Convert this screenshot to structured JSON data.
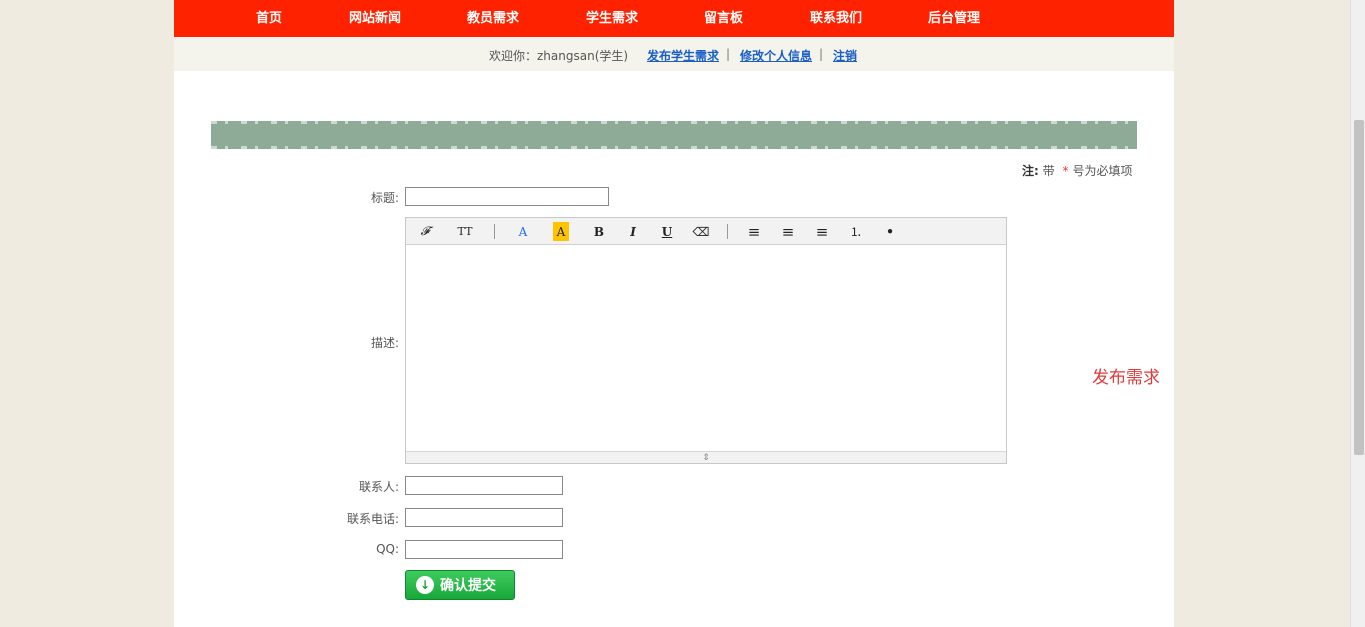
{
  "nav": {
    "items": [
      "首页",
      "网站新闻",
      "教员需求",
      "学生需求",
      "留言板",
      "联系我们",
      "后台管理"
    ]
  },
  "welcome": {
    "text": "欢迎你：zhangsan(学生)",
    "links": [
      "发布学生需求",
      "修改个人信息",
      "注销"
    ],
    "separator": "|"
  },
  "note": {
    "prefix": "注:",
    "middle": "带",
    "star": "*",
    "suffix": "号为必填项"
  },
  "form": {
    "title_label": "标题:",
    "desc_label": "描述:",
    "contact_label": "联系人:",
    "phone_label": "联系电话:",
    "qq_label": "QQ:",
    "title_value": "",
    "contact_value": "",
    "phone_value": "",
    "qq_value": ""
  },
  "editor": {
    "toolbar": {
      "font_family": "𝓕",
      "font_size": "TT",
      "font_color": "A",
      "bg_color": "A",
      "bold": "B",
      "italic": "I",
      "underline": "U",
      "eraser": "⌫",
      "align_left": "≡",
      "align_center": "≡",
      "align_right": "≡",
      "ordered_list": "⒈",
      "unordered_list": "•"
    },
    "resize_handle": "⇕"
  },
  "side": {
    "publish_label": "发布需求"
  },
  "submit": {
    "label": "确认提交",
    "icon": "↓"
  },
  "colors": {
    "nav_bg": "#ff2200",
    "link": "#1a5fc6",
    "accent_red": "#e03a3a",
    "submit_green": "#18a83a"
  }
}
